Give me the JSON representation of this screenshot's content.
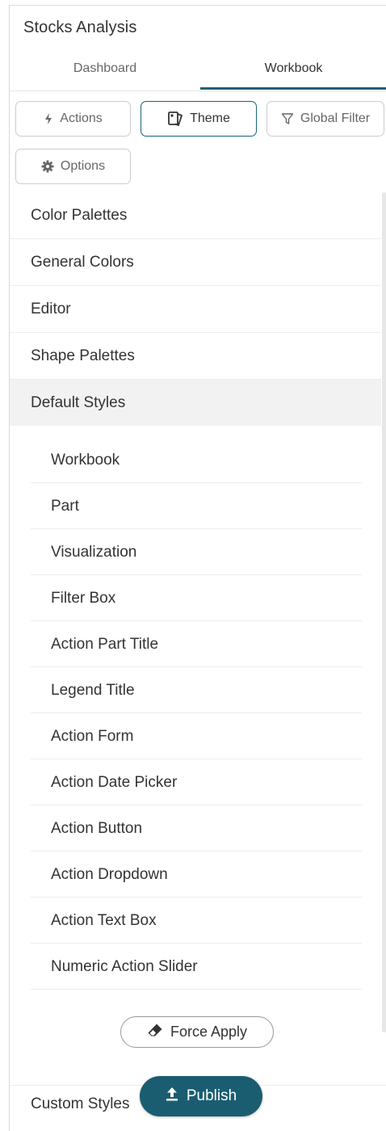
{
  "app": {
    "title": "Stocks Analysis"
  },
  "tabs": [
    {
      "label": "Dashboard",
      "active": false
    },
    {
      "label": "Workbook",
      "active": true
    }
  ],
  "toolbar": {
    "actions_label": "Actions",
    "actions_icon": "bolt-icon",
    "theme_label": "Theme",
    "theme_icon": "theme-book-icon",
    "global_filter_label": "Global Filter",
    "global_filter_icon": "funnel-icon",
    "options_label": "Options",
    "options_icon": "gear-icon",
    "active": "Theme"
  },
  "sections": {
    "color_palettes": "Color Palettes",
    "general_colors": "General Colors",
    "editor": "Editor",
    "shape_palettes": "Shape Palettes",
    "default_styles": "Default Styles",
    "custom_styles": "Custom Styles"
  },
  "default_styles_items": [
    "Workbook",
    "Part",
    "Visualization",
    "Filter Box",
    "Action Part Title",
    "Legend Title",
    "Action Form",
    "Action Date Picker",
    "Action Button",
    "Action Dropdown",
    "Action Text Box",
    "Numeric Action Slider"
  ],
  "force_apply": {
    "label": "Force Apply",
    "icon": "eraser-icon"
  },
  "publish": {
    "label": "Publish",
    "icon": "upload-icon"
  },
  "colors": {
    "accent": "#1a6279",
    "publish_bg": "#1a5d71",
    "expanded_bg": "#f2f2f2"
  }
}
